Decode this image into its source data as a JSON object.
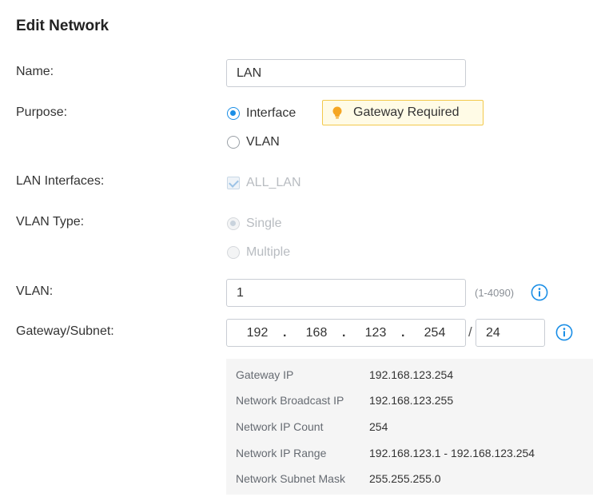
{
  "title": "Edit Network",
  "fields": {
    "name": {
      "label": "Name:",
      "value": "LAN"
    },
    "purpose": {
      "label": "Purpose:",
      "options": [
        {
          "label": "Interface",
          "selected": true
        },
        {
          "label": "VLAN",
          "selected": false
        }
      ],
      "notice": "Gateway Required",
      "notice_icon": "lightbulb-icon",
      "notice_color": "#f5a623"
    },
    "lan_interfaces": {
      "label": "LAN Interfaces:",
      "option": "ALL_LAN",
      "checked": true,
      "disabled": true
    },
    "vlan_type": {
      "label": "VLAN Type:",
      "options": [
        {
          "label": "Single",
          "selected": true,
          "disabled": true
        },
        {
          "label": "Multiple",
          "selected": false,
          "disabled": true
        }
      ]
    },
    "vlan": {
      "label": "VLAN:",
      "value": "1",
      "hint": "(1-4090)",
      "info_icon": "info-icon"
    },
    "gateway_subnet": {
      "label": "Gateway/Subnet:",
      "octets": [
        "192",
        "168",
        "123",
        "254"
      ],
      "separator": "/",
      "prefix": "24",
      "info_icon": "info-icon"
    }
  },
  "details": [
    {
      "label": "Gateway IP",
      "value": "192.168.123.254"
    },
    {
      "label": "Network Broadcast IP",
      "value": "192.168.123.255"
    },
    {
      "label": "Network IP Count",
      "value": "254"
    },
    {
      "label": "Network IP Range",
      "value": "192.168.123.1 - 192.168.123.254"
    },
    {
      "label": "Network Subnet Mask",
      "value": "255.255.255.0"
    }
  ],
  "colors": {
    "accent": "#1a8ee6",
    "notice_border": "#f2c94c",
    "notice_bg": "#fffbe6",
    "panel_bg": "#f5f5f5"
  }
}
